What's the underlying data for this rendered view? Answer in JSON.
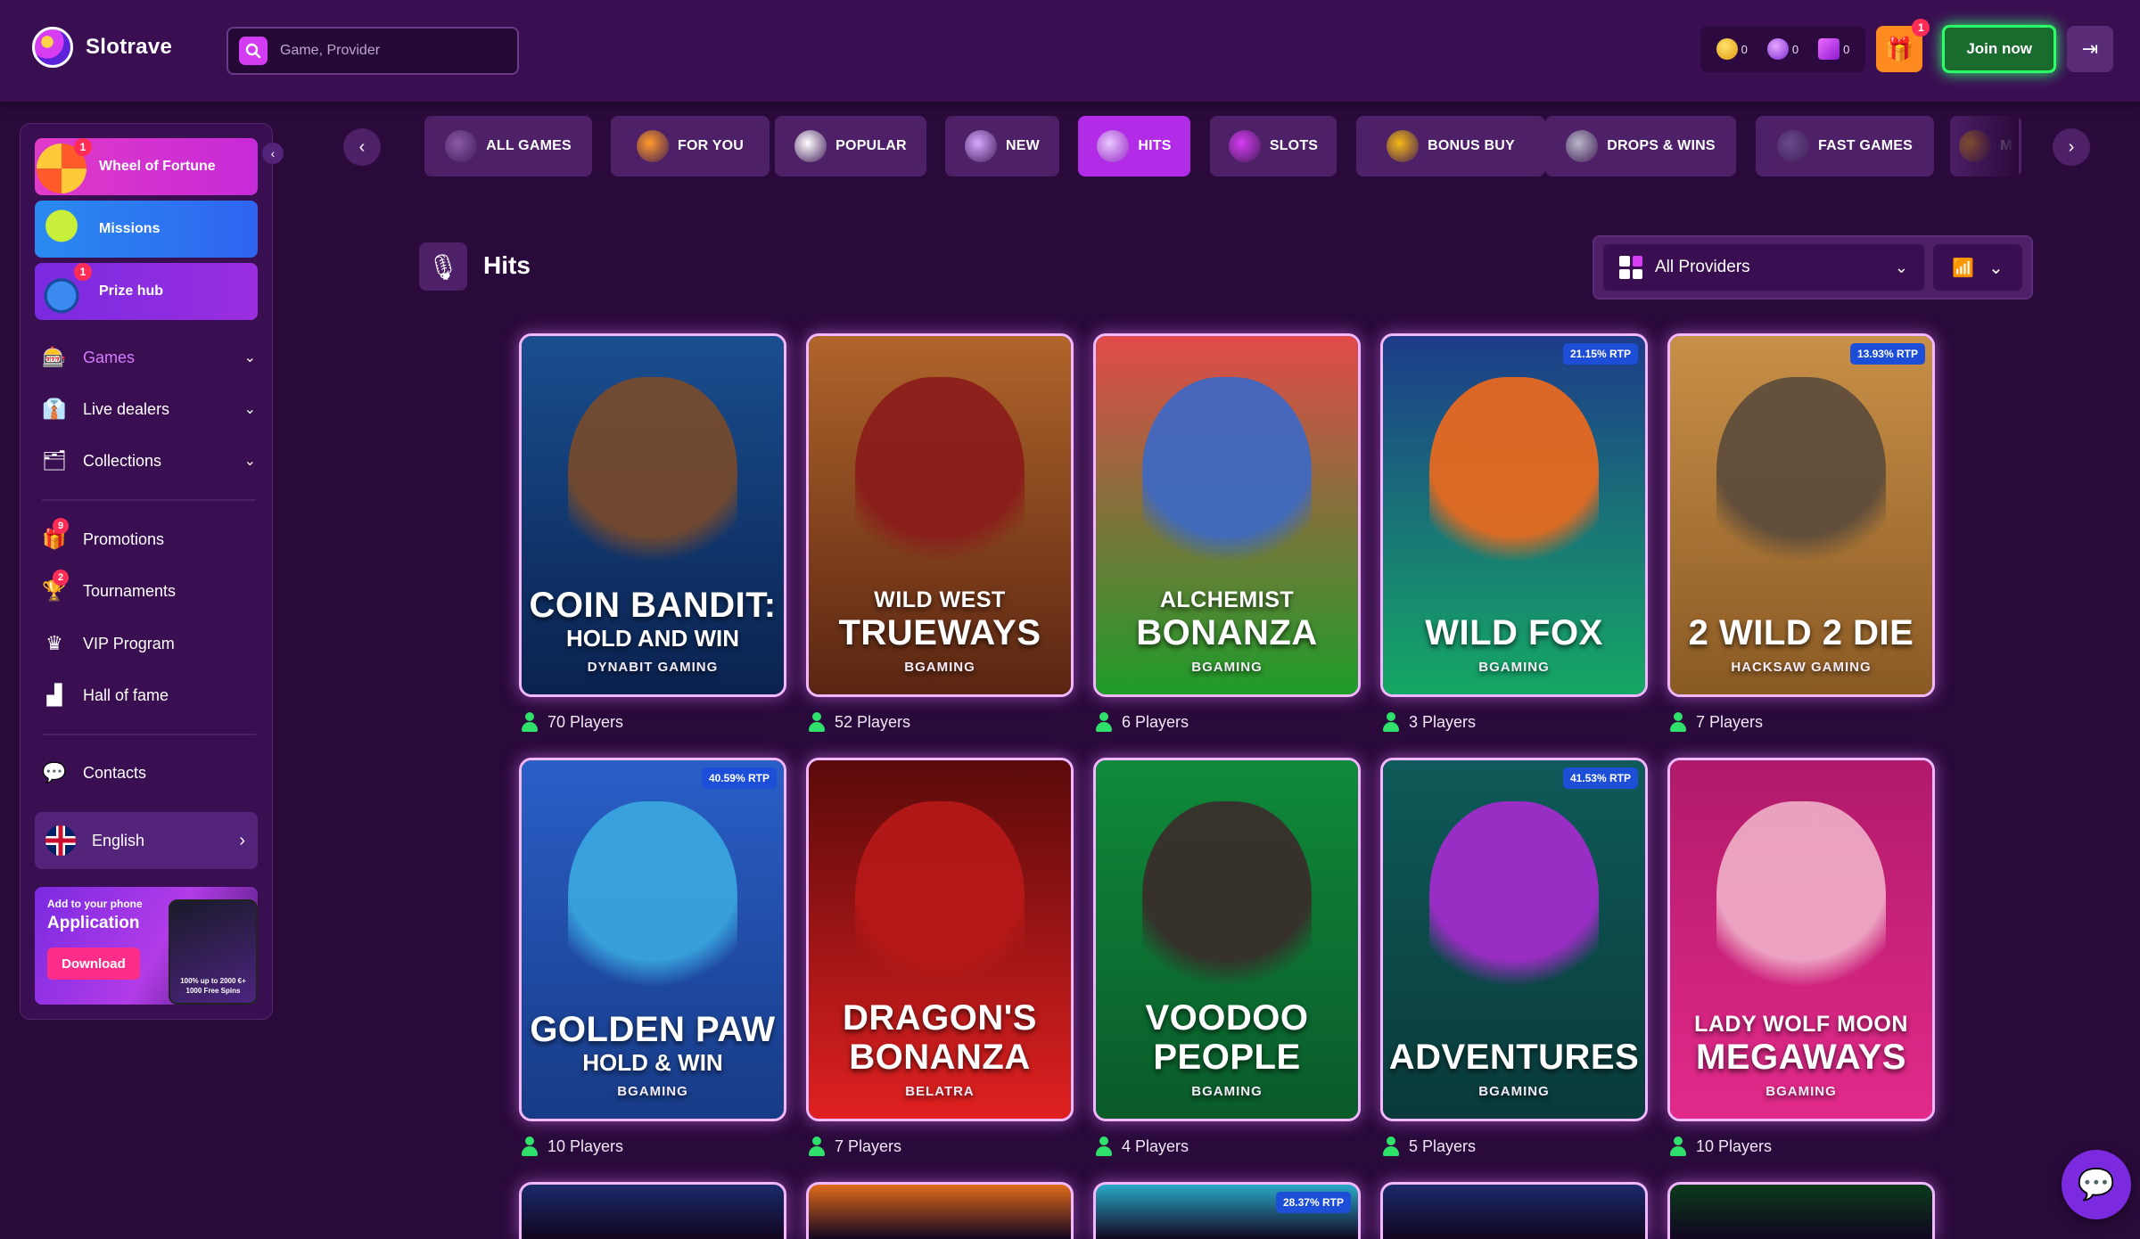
{
  "header": {
    "brand": "Slotrave",
    "search_placeholder": "Game, Provider",
    "wallet": [
      {
        "icon": "gold-coin-icon",
        "value": "0",
        "color": "#f5b915"
      },
      {
        "icon": "free-spin-icon",
        "value": "0",
        "color": "#b84cf0"
      },
      {
        "icon": "bonus-balance-icon",
        "value": "0",
        "color": "#d63cf2"
      }
    ],
    "gift_badge": "1",
    "join_label": "Join now"
  },
  "sidebar": {
    "promos": [
      {
        "label": "Wheel of Fortune",
        "badge": "1",
        "bg": "#c72ad8"
      },
      {
        "label": "Missions",
        "badge": "",
        "bg": "#2f64f0"
      },
      {
        "label": "Prize hub",
        "badge": "1",
        "bg": "#9b2ee0"
      }
    ],
    "nav": [
      {
        "label": "Games",
        "icon": "slot-machine-icon",
        "expandable": true,
        "active": true
      },
      {
        "label": "Live dealers",
        "icon": "dealer-icon",
        "expandable": true
      },
      {
        "label": "Collections",
        "icon": "collections-icon",
        "expandable": true
      }
    ],
    "nav2": [
      {
        "label": "Promotions",
        "icon": "gift-bag-icon",
        "badge": "9"
      },
      {
        "label": "Tournaments",
        "icon": "trophy-icon",
        "badge": "2"
      },
      {
        "label": "VIP Program",
        "icon": "crown-icon",
        "badge": ""
      },
      {
        "label": "Hall of fame",
        "icon": "podium-icon",
        "badge": ""
      }
    ],
    "contacts": "Contacts",
    "language": "English",
    "app_banner": {
      "small": "Add to your phone",
      "big": "Application",
      "button": "Download",
      "phone_line1": "100% up to 2000 €+",
      "phone_line2": "1000 Free Spins"
    }
  },
  "categories": [
    {
      "label": "ALL GAMES",
      "icon": "dice-icon",
      "active": false
    },
    {
      "label": "FOR YOU",
      "icon": "hand-icon",
      "active": false
    },
    {
      "label": "POPULAR",
      "icon": "star-icon",
      "active": false
    },
    {
      "label": "NEW",
      "icon": "sparkle-icon",
      "active": false
    },
    {
      "label": "HITS",
      "icon": "microphone-icon",
      "active": true
    },
    {
      "label": "SLOTS",
      "icon": "slot-icon",
      "active": false
    },
    {
      "label": "BONUS BUY",
      "icon": "coin-icon",
      "active": false
    },
    {
      "label": "DROPS & WINS",
      "icon": "drops-wins-icon",
      "active": false
    },
    {
      "label": "FAST GAMES",
      "icon": "bomb-icon",
      "active": false
    },
    {
      "label": "M",
      "icon": "megaways-icon",
      "active": false
    }
  ],
  "section": {
    "title": "Hits",
    "provider_filter": "All Providers"
  },
  "games": [
    {
      "sub1": "",
      "title": "COIN BANDIT:",
      "sub2": "HOLD AND WIN",
      "provider": "DYNABIT GAMING",
      "players": "70 Players",
      "rtp": "",
      "bg": [
        "#1a4e8f",
        "#0a2250"
      ],
      "fig": "#7a4a2a"
    },
    {
      "sub1": "WILD WEST",
      "title": "TRUEWAYS",
      "sub2": "",
      "provider": "BGAMING",
      "players": "52 Players",
      "rtp": "",
      "bg": [
        "#b0652a",
        "#5a2512"
      ],
      "fig": "#8a1a1a"
    },
    {
      "sub1": "ALCHEMIST",
      "title": "BONANZA",
      "sub2": "",
      "provider": "BGAMING",
      "players": "6 Players",
      "rtp": "",
      "bg": [
        "#e24a4a",
        "#1e9c2a"
      ],
      "fig": "#3a68c8"
    },
    {
      "sub1": "",
      "title": "WILD FOX",
      "sub2": "",
      "provider": "BGAMING",
      "players": "3 Players",
      "rtp": "21.15% RTP",
      "bg": [
        "#1d3c8a",
        "#15a864"
      ],
      "fig": "#f06a1c"
    },
    {
      "sub1": "",
      "title": "2 WILD 2 DIE",
      "sub2": "",
      "provider": "HACKSAW GAMING",
      "players": "7 Players",
      "rtp": "13.93% RTP",
      "bg": [
        "#c89048",
        "#8a5a24"
      ],
      "fig": "#5a4a3a"
    },
    {
      "sub1": "",
      "title": "GOLDEN PAW",
      "sub2": "HOLD & WIN",
      "provider": "BGAMING",
      "players": "10 Players",
      "rtp": "40.59% RTP",
      "bg": [
        "#2a5fc8",
        "#173b86"
      ],
      "fig": "#3aa8e0"
    },
    {
      "sub1": "",
      "title": "DRAGON'S BONANZA",
      "sub2": "",
      "provider": "BELATRA",
      "players": "7 Players",
      "rtp": "",
      "bg": [
        "#5a0a0a",
        "#e02020"
      ],
      "fig": "#b81818"
    },
    {
      "sub1": "",
      "title": "VOODOO PEOPLE",
      "sub2": "",
      "provider": "BGAMING",
      "players": "4 Players",
      "rtp": "",
      "bg": [
        "#0f8a3a",
        "#0a5a2a"
      ],
      "fig": "#3a2a2a"
    },
    {
      "sub1": "",
      "title": "ADVENTURES",
      "sub2": "",
      "provider": "BGAMING",
      "players": "5 Players",
      "rtp": "41.53% RTP",
      "bg": [
        "#0f5a5a",
        "#0a3a3a"
      ],
      "fig": "#a82ad0"
    },
    {
      "sub1": "LADY WOLF MOON",
      "title": "MEGAWAYS",
      "sub2": "",
      "provider": "BGAMING",
      "players": "10 Players",
      "rtp": "",
      "bg": [
        "#b01a6a",
        "#e22a8a"
      ],
      "fig": "#f0b0c8"
    }
  ],
  "partial_row_rtp": "28.37% RTP",
  "partial_row_bgs": [
    "#1a2a6a",
    "#e06a1a",
    "#2aa8c8",
    "#1a2a6a",
    "#0a3a1a"
  ],
  "colors": {
    "background": "#2a0a3b",
    "panel": "#3a0f52",
    "accent": "#b22ce8",
    "join_green": "#2dff6a"
  }
}
